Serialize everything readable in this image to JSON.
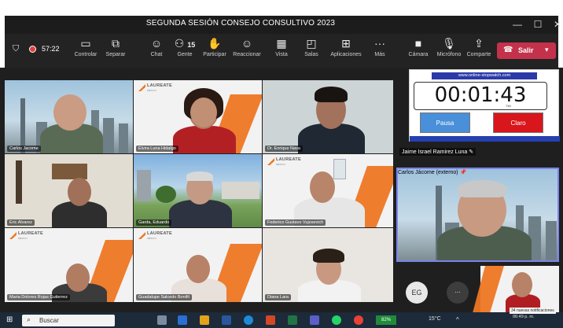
{
  "window": {
    "title": "SEGUNDA SESIÓN CONSEJO CONSULTIVO 2023"
  },
  "window_controls": {
    "minimize": "—",
    "maximize": "☐",
    "close": "✕"
  },
  "toolbar": {
    "timer": "57:22",
    "items": [
      {
        "label": "Controlar",
        "icon": "control-icon"
      },
      {
        "label": "Separar",
        "icon": "popout-icon"
      },
      {
        "label": "Chat",
        "icon": "chat-icon"
      },
      {
        "label": "Gente",
        "icon": "people-icon",
        "count": "15"
      },
      {
        "label": "Participar",
        "icon": "raise-hand-icon"
      },
      {
        "label": "Reaccionar",
        "icon": "react-icon"
      },
      {
        "label": "Vista",
        "icon": "view-icon"
      },
      {
        "label": "Salas",
        "icon": "rooms-icon"
      },
      {
        "label": "Aplicaciones",
        "icon": "apps-icon"
      },
      {
        "label": "Más",
        "icon": "more-icon"
      },
      {
        "label": "Cámara",
        "icon": "camera-icon"
      },
      {
        "label": "Micrófono",
        "icon": "mic-off-icon"
      },
      {
        "label": "Comparte",
        "icon": "share-icon"
      }
    ],
    "leave": "Salir"
  },
  "participants": [
    {
      "name": "Carlos Jacome"
    },
    {
      "name": "Elvira Luna Hidalgo"
    },
    {
      "name": "Dr. Enrique Nava"
    },
    {
      "name": "Eric Alvarez"
    },
    {
      "name": "Garda, Eduardo"
    },
    {
      "name": "Federico Gustavo Vujosevich"
    },
    {
      "name": "Maria Dolores Rojas Gutierrez"
    },
    {
      "name": "Guadalupe Salcedo Bonifil"
    },
    {
      "name": "Diana Lara"
    }
  ],
  "laureate": {
    "brand": "LAUREATE",
    "sub": "MÉXICO"
  },
  "stopwatch": {
    "url": "www.online-stopwatch.com",
    "time": "00:01:43",
    "ms": "746",
    "pause": "Pausa",
    "clear": "Claro"
  },
  "screen_share_presenter": "Jaime Israel Ramirez Luna",
  "featured": {
    "name": "Carlos Jácome (externo)"
  },
  "avatar_initials": "EG",
  "more_label": "...",
  "taskbar": {
    "search_placeholder": "Buscar",
    "temperature": "15°C",
    "battery_label": "82%",
    "time": "06:49 p. m.",
    "notifications": "34 nuevas notificaciones"
  }
}
